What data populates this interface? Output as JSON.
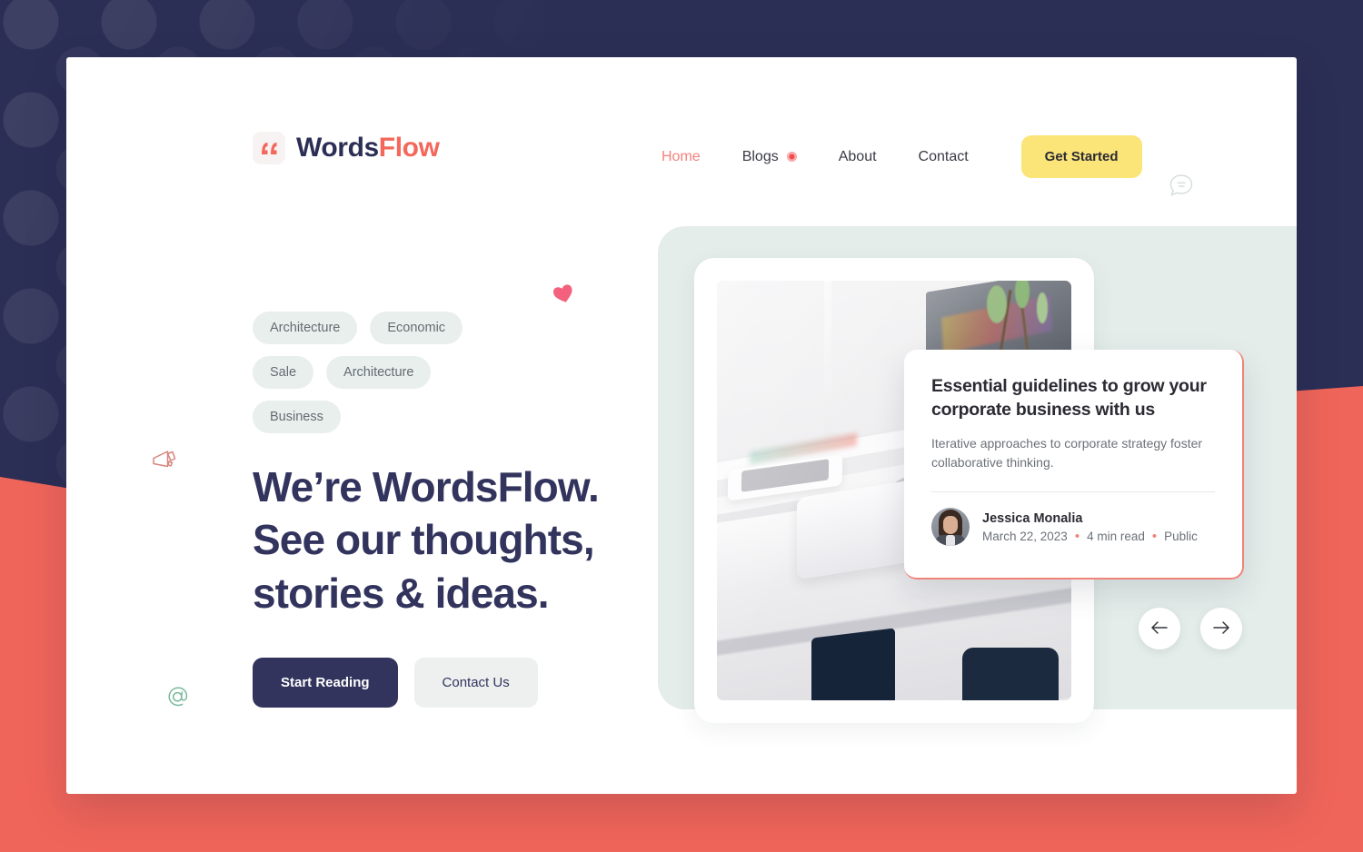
{
  "brand": {
    "name_primary": "Words",
    "name_accent": "Flow",
    "logo_icon": "quote-icon",
    "accent_color": "#F4685C",
    "navy_color": "#32345D",
    "yellow_color": "#FBE478",
    "mint_color": "#E4EDEA",
    "coral_bg_color": "#F0655A"
  },
  "nav": {
    "items": [
      {
        "label": "Home",
        "active": true,
        "badge": false
      },
      {
        "label": "Blogs",
        "active": false,
        "badge": true
      },
      {
        "label": "About",
        "active": false,
        "badge": false
      },
      {
        "label": "Contact",
        "active": false,
        "badge": false
      }
    ],
    "cta_label": "Get Started"
  },
  "hero": {
    "tags": [
      "Architecture",
      "Economic",
      "Sale",
      "Architecture",
      "Business"
    ],
    "headline_line1": "We’re WordsFlow.",
    "headline_line2": "See our thoughts,",
    "headline_line3": "stories & ideas.",
    "primary_button": "Start Reading",
    "secondary_button": "Contact Us"
  },
  "decor": {
    "chat_icon": "chat-bubble-icon",
    "heart_icon": "heart-icon",
    "at_icon": "at-sign-icon",
    "megaphone_icon": "megaphone-icon"
  },
  "featured": {
    "image_alt": "desk-photo",
    "title": "Essential guidelines to grow your corporate business with us",
    "description": "Iterative approaches to corporate strategy foster collaborative thinking.",
    "author": {
      "name": "Jessica Monalia",
      "date": "March 22, 2023",
      "read_time": "4 min read",
      "visibility": "Public",
      "separator": "•"
    }
  },
  "carousel": {
    "prev_icon": "arrow-left-icon",
    "next_icon": "arrow-right-icon"
  }
}
